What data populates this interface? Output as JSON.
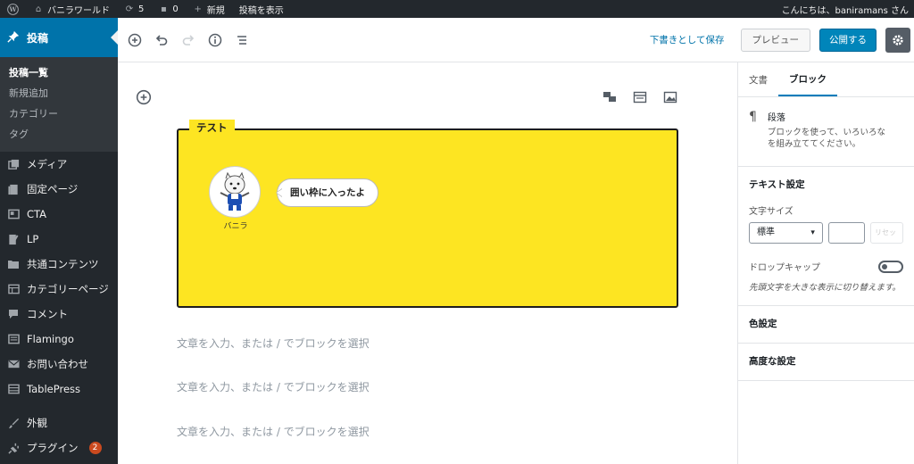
{
  "adminbar": {
    "site_name": "バニラワールド",
    "updates_count": "5",
    "comments_count": "0",
    "new_label": "新規",
    "view_post_label": "投稿を表示",
    "greeting": "こんにちは、baniramans さん"
  },
  "sidebar": {
    "posts_label": "投稿",
    "submenu": [
      "投稿一覧",
      "新規追加",
      "カテゴリー",
      "タグ"
    ],
    "items": [
      {
        "label": "メディア",
        "icon": "media-icon"
      },
      {
        "label": "固定ページ",
        "icon": "page-icon"
      },
      {
        "label": "CTA",
        "icon": "cta-icon"
      },
      {
        "label": "LP",
        "icon": "lp-icon"
      },
      {
        "label": "共通コンテンツ",
        "icon": "folder-icon"
      },
      {
        "label": "カテゴリーページ",
        "icon": "category-page-icon"
      },
      {
        "label": "コメント",
        "icon": "comment-icon"
      },
      {
        "label": "Flamingo",
        "icon": "flamingo-icon"
      },
      {
        "label": "お問い合わせ",
        "icon": "mail-icon"
      },
      {
        "label": "TablePress",
        "icon": "table-icon"
      }
    ],
    "appearance_label": "外観",
    "plugins_label": "プラグイン",
    "plugins_badge": "2"
  },
  "header": {
    "save_draft": "下書きとして保存",
    "preview": "プレビュー",
    "publish": "公開する"
  },
  "content": {
    "frame_title": "テスト",
    "speaker_name": "バニラ",
    "bubble_text": "囲い枠に入ったよ",
    "placeholders": [
      "文章を入力、または / でブロックを選択",
      "文章を入力、または / でブロックを選択",
      "文章を入力、または / でブロックを選択"
    ]
  },
  "inspector": {
    "tab_document": "文書",
    "tab_block": "ブロック",
    "block_title": "段落",
    "block_desc_line1": "ブロックを使って、いろいろな",
    "block_desc_line2": "を組み立ててください。",
    "text_settings": "テキスト設定",
    "font_size_label": "文字サイズ",
    "font_size_value": "標準",
    "reset_label": "リセット",
    "drop_cap_label": "ドロップキャップ",
    "drop_cap_help": "先頭文字を大きな表示に切り替えます。",
    "color_settings": "色設定",
    "advanced": "高度な設定"
  },
  "colors": {
    "accent": "#0073aa",
    "frame_bg": "#fde522",
    "admin_dark": "#23282d"
  }
}
